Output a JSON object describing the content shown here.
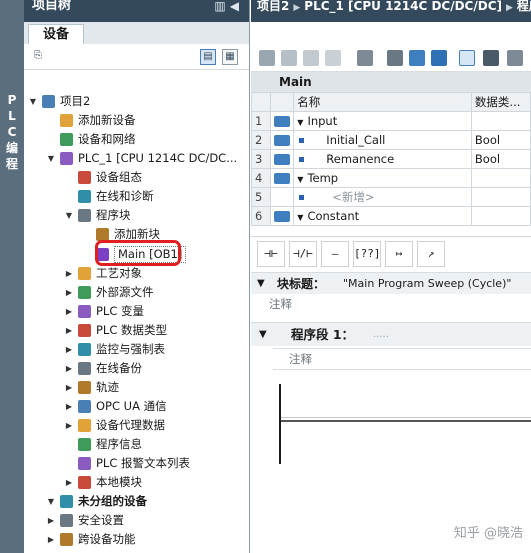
{
  "side_tab": {
    "label": [
      "P",
      "L",
      "C",
      "编",
      "程"
    ]
  },
  "left_panel": {
    "title": "项目树",
    "tab": "设备",
    "tree": [
      {
        "label": "项目2",
        "level": 0,
        "expanded": true,
        "icon": "project-icon"
      },
      {
        "label": "添加新设备",
        "level": 1,
        "icon": "add-device-icon"
      },
      {
        "label": "设备和网络",
        "level": 1,
        "icon": "network-icon"
      },
      {
        "label": "PLC_1 [CPU 1214C DC/DC...",
        "level": 1,
        "expanded": true,
        "icon": "plc-icon"
      },
      {
        "label": "设备组态",
        "level": 2,
        "icon": "device-config-icon"
      },
      {
        "label": "在线和诊断",
        "level": 2,
        "icon": "online-diagnostics-icon"
      },
      {
        "label": "程序块",
        "level": 2,
        "expanded": true,
        "icon": "program-blocks-icon"
      },
      {
        "label": "添加新块",
        "level": 3,
        "icon": "add-block-icon"
      },
      {
        "label": "Main [OB1]",
        "level": 3,
        "icon": "ob-block-icon",
        "highlighted": true
      },
      {
        "label": "工艺对象",
        "level": 2,
        "collapsed": true,
        "icon": "technology-objects-icon"
      },
      {
        "label": "外部源文件",
        "level": 2,
        "collapsed": true,
        "icon": "external-source-icon"
      },
      {
        "label": "PLC 变量",
        "level": 2,
        "collapsed": true,
        "icon": "plc-tags-icon"
      },
      {
        "label": "PLC 数据类型",
        "level": 2,
        "collapsed": true,
        "icon": "plc-data-types-icon"
      },
      {
        "label": "监控与强制表",
        "level": 2,
        "collapsed": true,
        "icon": "watch-table-icon"
      },
      {
        "label": "在线备份",
        "level": 2,
        "collapsed": true,
        "icon": "online-backup-icon"
      },
      {
        "label": "轨迹",
        "level": 2,
        "collapsed": true,
        "icon": "trace-icon"
      },
      {
        "label": "OPC UA 通信",
        "level": 2,
        "collapsed": true,
        "icon": "opcua-icon"
      },
      {
        "label": "设备代理数据",
        "level": 2,
        "collapsed": true,
        "icon": "device-proxy-icon"
      },
      {
        "label": "程序信息",
        "level": 2,
        "icon": "program-info-icon"
      },
      {
        "label": "PLC 报警文本列表",
        "level": 2,
        "icon": "alarm-text-icon"
      },
      {
        "label": "本地模块",
        "level": 2,
        "collapsed": true,
        "icon": "local-modules-icon"
      },
      {
        "label": "未分组的设备",
        "level": 1,
        "expanded": true,
        "bold": true,
        "icon": "ungrouped-devices-icon"
      },
      {
        "label": "安全设置",
        "level": 1,
        "collapsed": true,
        "icon": "security-settings-icon"
      },
      {
        "label": "跨设备功能",
        "level": 1,
        "collapsed": true,
        "icon": "cross-device-icon"
      }
    ]
  },
  "editor": {
    "breadcrumb": [
      "项目2",
      "PLC_1 [CPU 1214C DC/DC/DC]",
      "程序块"
    ],
    "interface_title": "Main",
    "columns": {
      "name": "名称",
      "datatype": "数据类..."
    },
    "rows": [
      {
        "num": "1",
        "name": "Input",
        "type": "",
        "kind": "section"
      },
      {
        "num": "2",
        "name": "Initial_Call",
        "type": "Bool",
        "kind": "var"
      },
      {
        "num": "3",
        "name": "Remanence",
        "type": "Bool",
        "kind": "var"
      },
      {
        "num": "4",
        "name": "Temp",
        "type": "",
        "kind": "section"
      },
      {
        "num": "5",
        "name": "<新增>",
        "type": "",
        "kind": "new"
      },
      {
        "num": "6",
        "name": "Constant",
        "type": "",
        "kind": "section"
      }
    ],
    "ladder_buttons": [
      "⊣⊢",
      "⊣/⊢",
      "–()–",
      "[??]",
      "↦",
      "↗"
    ],
    "block_title_label": "块标题：",
    "block_title_value": "\"Main Program Sweep (Cycle)\"",
    "block_comment": "注释",
    "network_label": "程序段 1：",
    "network_dots": ".....",
    "network_comment": "注释"
  },
  "watermark": "知乎 @晓浩",
  "colors": {
    "header_bg": "#34495c",
    "side_strip": "#5b6e7e",
    "highlight_ring": "#e02020",
    "io_badge": "#3f7fc0"
  }
}
